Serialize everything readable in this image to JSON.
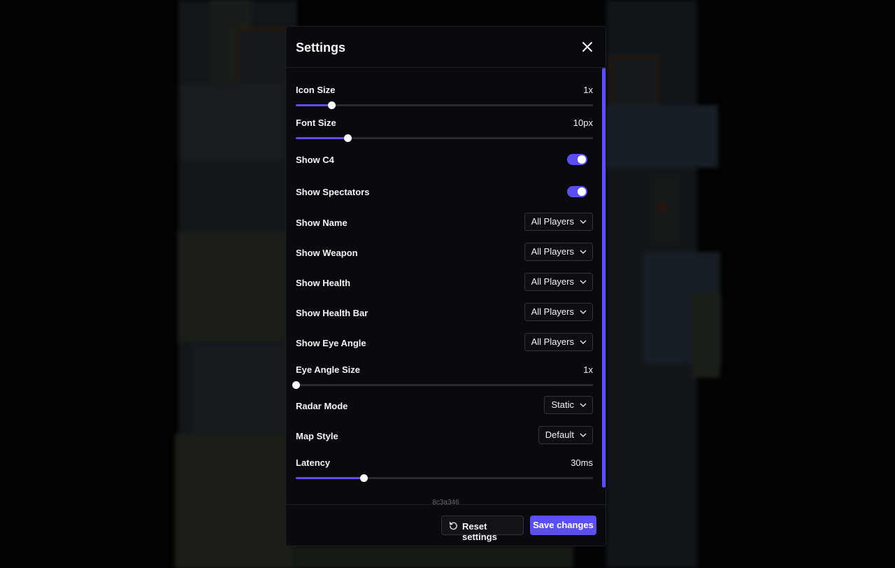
{
  "colors": {
    "accent": "#5b4ff0",
    "panel": "#0a090d",
    "border": "#34333a"
  },
  "modal": {
    "title": "Settings",
    "close_icon": "close-icon"
  },
  "settings": {
    "icon_size": {
      "label": "Icon Size",
      "value": "1x",
      "fill": 0.12
    },
    "font_size": {
      "label": "Font Size",
      "value": "10px",
      "fill": 0.175
    },
    "show_c4": {
      "label": "Show C4",
      "enabled": true
    },
    "show_spectators": {
      "label": "Show Spectators",
      "enabled": true
    },
    "show_name": {
      "label": "Show Name",
      "selected": "All Players"
    },
    "show_weapon": {
      "label": "Show Weapon",
      "selected": "All Players"
    },
    "show_health": {
      "label": "Show Health",
      "selected": "All Players"
    },
    "show_health_bar": {
      "label": "Show Health Bar",
      "selected": "All Players"
    },
    "show_eye_angle": {
      "label": "Show Eye Angle",
      "selected": "All Players"
    },
    "eye_angle_size": {
      "label": "Eye Angle Size",
      "value": "1x",
      "fill": 0.0
    },
    "radar_mode": {
      "label": "Radar Mode",
      "selected": "Static"
    },
    "map_style": {
      "label": "Map Style",
      "selected": "Default"
    },
    "latency": {
      "label": "Latency",
      "value": "30ms",
      "fill": 0.228
    }
  },
  "version": "8c3a346",
  "footer": {
    "reset_label": "Reset settings",
    "save_label": "Save changes"
  }
}
